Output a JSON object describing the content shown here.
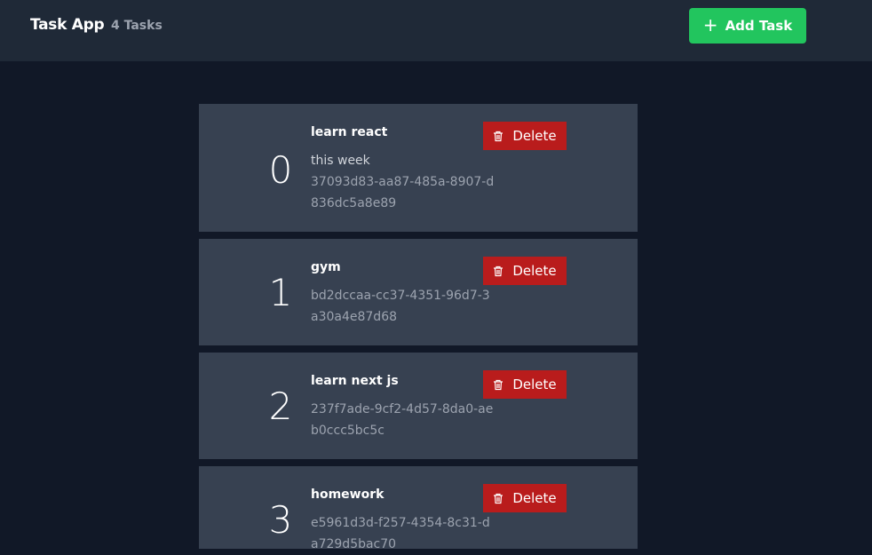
{
  "header": {
    "brand": "Task App",
    "task_count": "4 Tasks",
    "add_label": "Add Task",
    "add_icon": "plus-icon"
  },
  "colors": {
    "background": "#111827",
    "navbar": "#1f2937",
    "card": "#374151",
    "add_button": "#22c55e",
    "delete_button": "#b91c1c"
  },
  "tasks": [
    {
      "index": "0",
      "title": "learn react",
      "description": "this week",
      "id": "37093d83-aa87-485a-8907-d836dc5a8e89",
      "delete_label": "Delete"
    },
    {
      "index": "1",
      "title": "gym",
      "description": "",
      "id": "bd2dccaa-cc37-4351-96d7-3a30a4e87d68",
      "delete_label": "Delete"
    },
    {
      "index": "2",
      "title": "learn next js",
      "description": "",
      "id": "237f7ade-9cf2-4d57-8da0-aeb0ccc5bc5c",
      "delete_label": "Delete"
    },
    {
      "index": "3",
      "title": "homework",
      "description": "",
      "id": "e5961d3d-f257-4354-8c31-da729d5bac70",
      "delete_label": "Delete"
    }
  ]
}
